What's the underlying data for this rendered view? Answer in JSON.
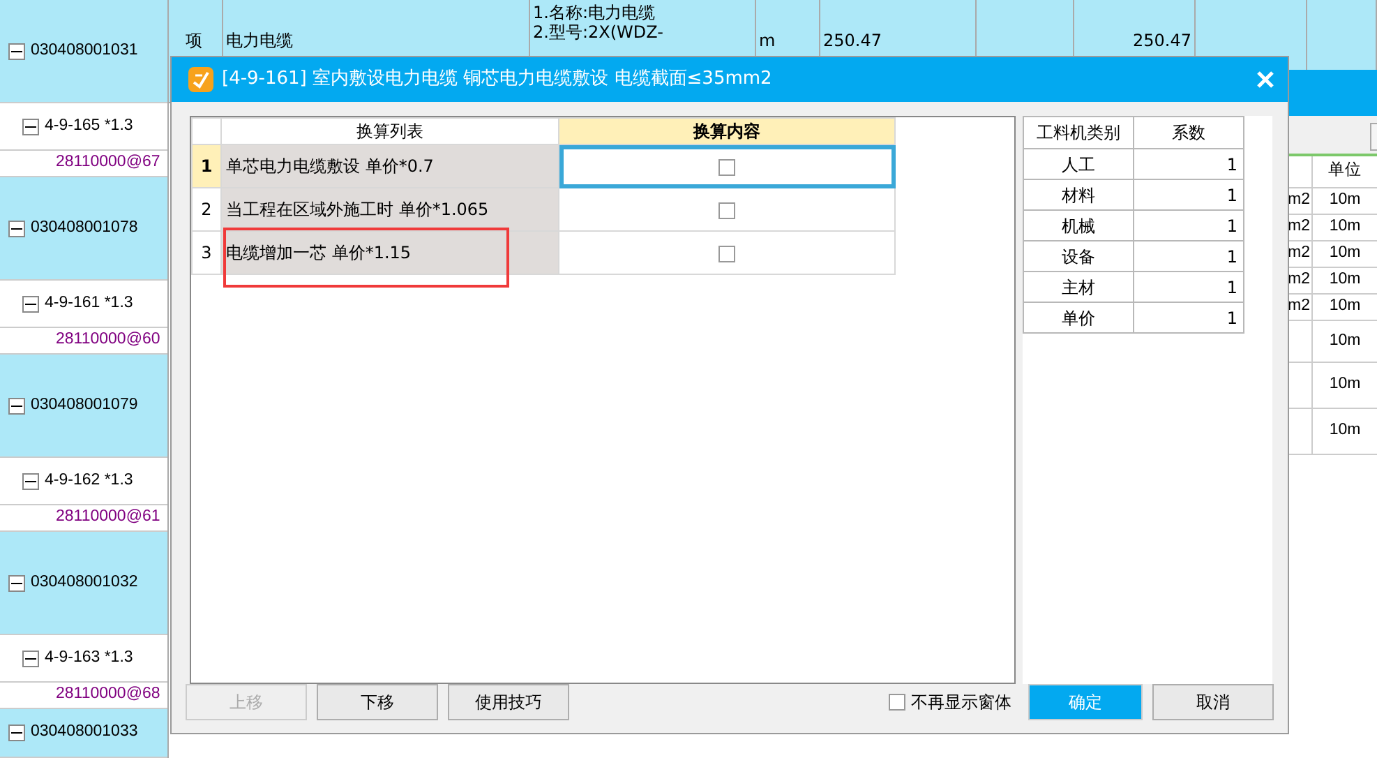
{
  "background_table": {
    "first_row": {
      "type": "项",
      "name": "电力电缆",
      "description_lines": [
        "1.名称:电力电缆",
        "2.型号:2X(WDZ-"
      ],
      "unit": "m",
      "quantity": "250.47",
      "column_8": "250.47"
    },
    "tree": [
      {
        "kind": "item",
        "code": "030408001031",
        "expanded": true
      },
      {
        "kind": "quota",
        "code": "4-9-165 *1.3",
        "expanded": true
      },
      {
        "kind": "material",
        "code": "28110000@67"
      },
      {
        "kind": "item",
        "code": "030408001078",
        "expanded": true
      },
      {
        "kind": "quota",
        "code": "4-9-161 *1.3",
        "expanded": true
      },
      {
        "kind": "material",
        "code": "28110000@60"
      },
      {
        "kind": "item",
        "code": "030408001079",
        "expanded": true
      },
      {
        "kind": "quota",
        "code": "4-9-162 *1.3",
        "expanded": true
      },
      {
        "kind": "material",
        "code": "28110000@61"
      },
      {
        "kind": "item",
        "code": "030408001032",
        "expanded": true
      },
      {
        "kind": "quota",
        "code": "4-9-163 *1.3",
        "expanded": true
      },
      {
        "kind": "material",
        "code": "28110000@68"
      },
      {
        "kind": "item",
        "code": "030408001033",
        "expanded": true
      }
    ]
  },
  "rear_window": {
    "header": "单位",
    "rows": [
      {
        "column_1": "m2",
        "unit": "10m"
      },
      {
        "column_1": "m2",
        "unit": "10m"
      },
      {
        "column_1": "m2",
        "unit": "10m"
      },
      {
        "column_1": "m2",
        "unit": "10m"
      },
      {
        "column_1": "m2",
        "unit": "10m"
      },
      {
        "unit": "10m"
      },
      {
        "unit": "10m"
      },
      {
        "unit": "10m"
      }
    ]
  },
  "dialog": {
    "title": "[4-9-161] 室内敷设电力电缆 铜芯电力电缆敷设 电缆截面≤35mm2",
    "grid": {
      "columns": [
        "换算列表",
        "换算内容"
      ],
      "rows": [
        {
          "number": "1",
          "label": "单芯电力电缆敷设 单价*0.7",
          "checked": false,
          "selected": true,
          "annotated": false
        },
        {
          "number": "2",
          "label": "当工程在区域外施工时 单价*1.065",
          "checked": false,
          "selected": false,
          "annotated": false
        },
        {
          "number": "3",
          "label": "电缆增加一芯 单价*1.15",
          "checked": false,
          "selected": false,
          "annotated": true
        }
      ]
    },
    "factors": {
      "columns": [
        "工料机类别",
        "系数"
      ],
      "rows": [
        {
          "category": "人工",
          "factor": "1"
        },
        {
          "category": "材料",
          "factor": "1"
        },
        {
          "category": "机械",
          "factor": "1"
        },
        {
          "category": "设备",
          "factor": "1"
        },
        {
          "category": "主材",
          "factor": "1"
        },
        {
          "category": "单价",
          "factor": "1"
        }
      ]
    },
    "buttons": [
      {
        "label": "上移",
        "disabled": true
      },
      {
        "label": "下移",
        "disabled": false
      },
      {
        "label": "使用技巧",
        "disabled": false
      }
    ],
    "dont_show_again": {
      "label": "不再显示窗体",
      "checked": false
    },
    "footer_buttons": [
      {
        "label": "确定",
        "kind": "primary"
      },
      {
        "label": "取消",
        "kind": "default"
      }
    ]
  }
}
